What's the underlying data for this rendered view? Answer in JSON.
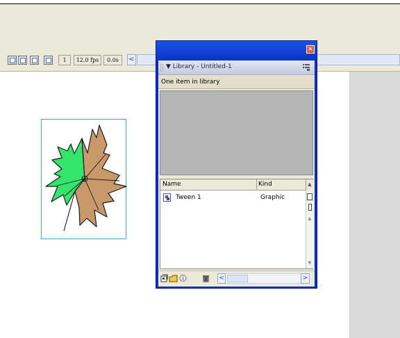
{
  "timeline": {
    "frame": "1",
    "fps": "12.0 fps",
    "time": "0.0s",
    "scroll_left_glyph": "<"
  },
  "library": {
    "title": "▼ Library - Untitled-1",
    "item_count": "One item in library",
    "close_glyph": "×",
    "columns": {
      "name": "Name",
      "kind": "Kind"
    },
    "items": [
      {
        "name": "Tween 1",
        "kind": "Graphic"
      }
    ],
    "sort_glyph": "▲",
    "scroll_left_glyph": "<",
    "scroll_right_glyph": ">"
  },
  "colors": {
    "leaf_green": "#33e56b",
    "leaf_brown": "#c9996a",
    "selection_border": "#3aa7d6",
    "window_blue": "#0d2bc8",
    "close_red": "#e5563a"
  },
  "icons": {
    "toolbar": [
      "onion-skin-icon",
      "onion-skin-outline-icon",
      "edit-multiple-frames-icon",
      "modify-onion-markers-icon"
    ],
    "library_bottom": [
      "new-symbol-icon",
      "new-folder-icon",
      "properties-icon",
      "delete-icon"
    ]
  }
}
